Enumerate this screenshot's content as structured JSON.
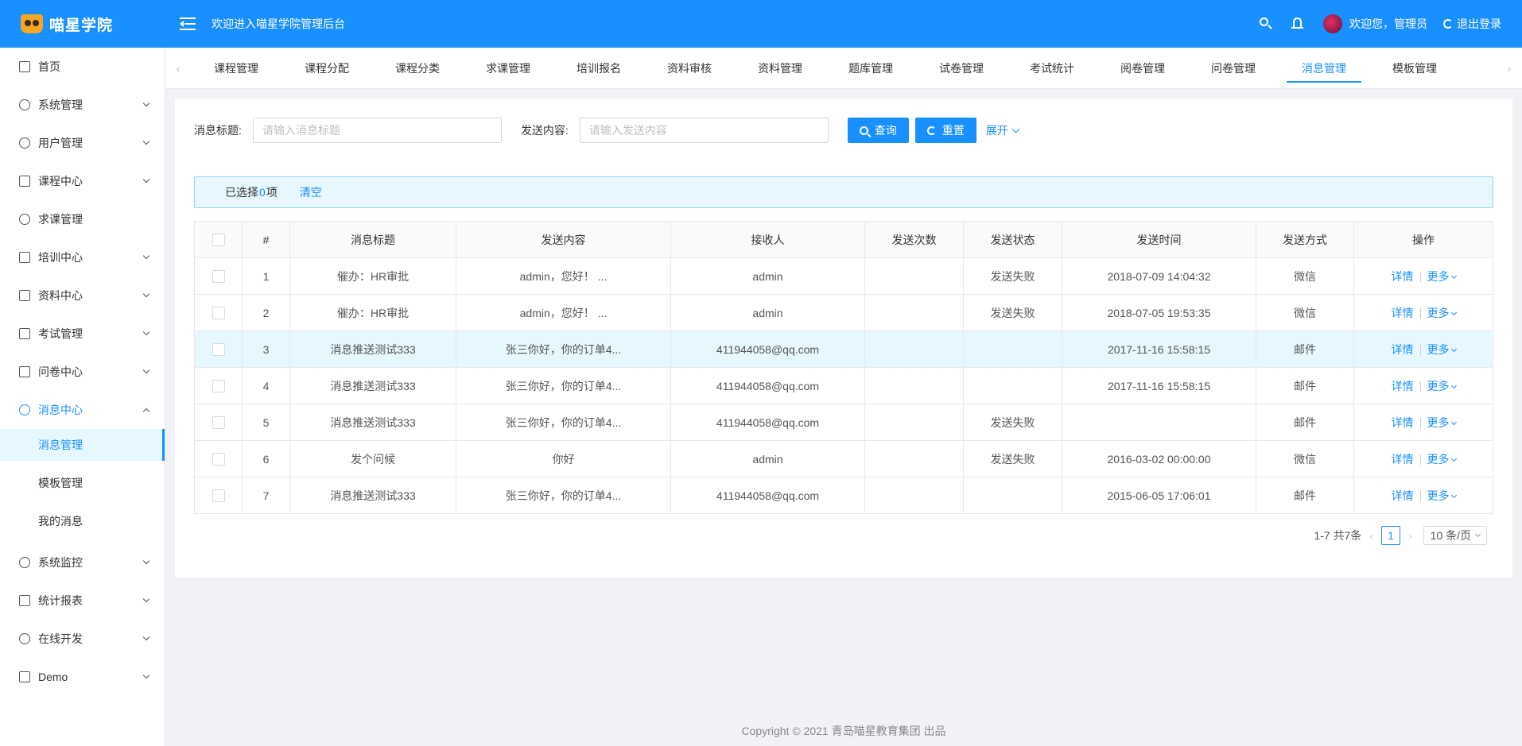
{
  "brand": {
    "name": "喵星学院"
  },
  "header": {
    "welcome": "欢迎进入喵星学院管理后台",
    "user_greeting": "欢迎您，管理员",
    "logout_label": "退出登录"
  },
  "sidebar": {
    "home": "首页",
    "items": [
      "系统管理",
      "用户管理",
      "课程中心",
      "求课管理",
      "培训中心",
      "资料中心",
      "考试管理",
      "问卷中心",
      "消息中心"
    ],
    "sub": [
      "消息管理",
      "模板管理",
      "我的消息"
    ],
    "items2": [
      "系统监控",
      "统计报表",
      "在线开发",
      "Demo"
    ]
  },
  "tabs": [
    "课程管理",
    "课程分配",
    "课程分类",
    "求课管理",
    "培训报名",
    "资料审核",
    "资料管理",
    "题库管理",
    "试卷管理",
    "考试统计",
    "阅卷管理",
    "问卷管理",
    "消息管理",
    "模板管理"
  ],
  "search": {
    "title_label": "消息标题:",
    "title_placeholder": "请输入消息标题",
    "content_label": "发送内容:",
    "content_placeholder": "请输入发送内容",
    "query_label": "查询",
    "reset_label": "重置",
    "expand_label": "展开"
  },
  "selection": {
    "prefix": "已选择",
    "count": "0",
    "suffix": "项",
    "clear": "清空"
  },
  "table": {
    "headers": [
      "#",
      "消息标题",
      "发送内容",
      "接收人",
      "发送次数",
      "发送状态",
      "发送时间",
      "发送方式",
      "操作"
    ],
    "rows": [
      [
        "1",
        "催办：HR审批",
        "admin，您好！ ...",
        "admin",
        "",
        "发送失败",
        "2018-07-09 14:04:32",
        "微信"
      ],
      [
        "2",
        "催办：HR审批",
        "admin，您好！ ...",
        "admin",
        "",
        "发送失败",
        "2018-07-05 19:53:35",
        "微信"
      ],
      [
        "3",
        "消息推送测试333",
        "张三你好，你的订单4...",
        "411944058@qq.com",
        "",
        "",
        "2017-11-16 15:58:15",
        "邮件"
      ],
      [
        "4",
        "消息推送测试333",
        "张三你好，你的订单4...",
        "411944058@qq.com",
        "",
        "",
        "2017-11-16 15:58:15",
        "邮件"
      ],
      [
        "5",
        "消息推送测试333",
        "张三你好，你的订单4...",
        "411944058@qq.com",
        "",
        "发送失败",
        "",
        "邮件"
      ],
      [
        "6",
        "发个问候",
        "你好",
        "admin",
        "",
        "发送失败",
        "2016-03-02 00:00:00",
        "微信"
      ],
      [
        "7",
        "消息推送测试333",
        "张三你好，你的订单4...",
        "411944058@qq.com",
        "",
        "",
        "2015-06-05 17:06:01",
        "邮件"
      ]
    ],
    "action_detail": "详情",
    "action_more": "更多"
  },
  "pagination": {
    "summary": "1-7 共7条",
    "current": "1",
    "page_size": "10 条/页"
  },
  "footer": {
    "text": "Copyright © 2021 青岛喵星教育集团 出品"
  },
  "colors": {
    "primary": "#1890ff",
    "highlight_row": "#e6f7ff",
    "background": "#f0f2f5"
  }
}
